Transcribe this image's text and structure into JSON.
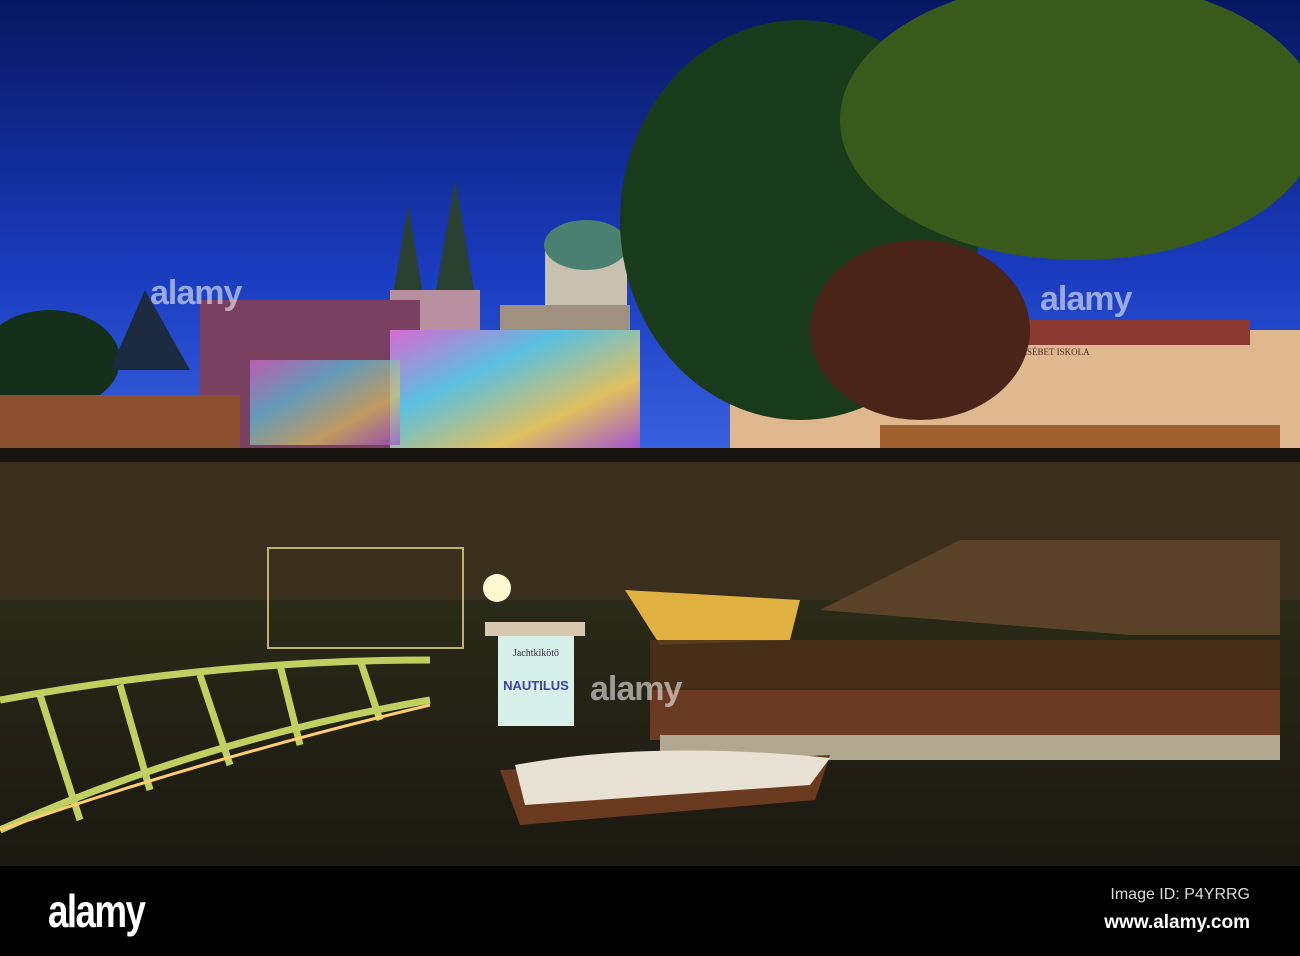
{
  "photo": {
    "school_sign": "ERZSÉBET ISKOLA",
    "dock_sign_top": "Jachtkikötő",
    "dock_sign_main": "NAUTILUS",
    "watermark": "alamy"
  },
  "footer": {
    "logo": "alamy",
    "image_id": "Image ID: P4YRRG",
    "url": "www.alamy.com"
  }
}
